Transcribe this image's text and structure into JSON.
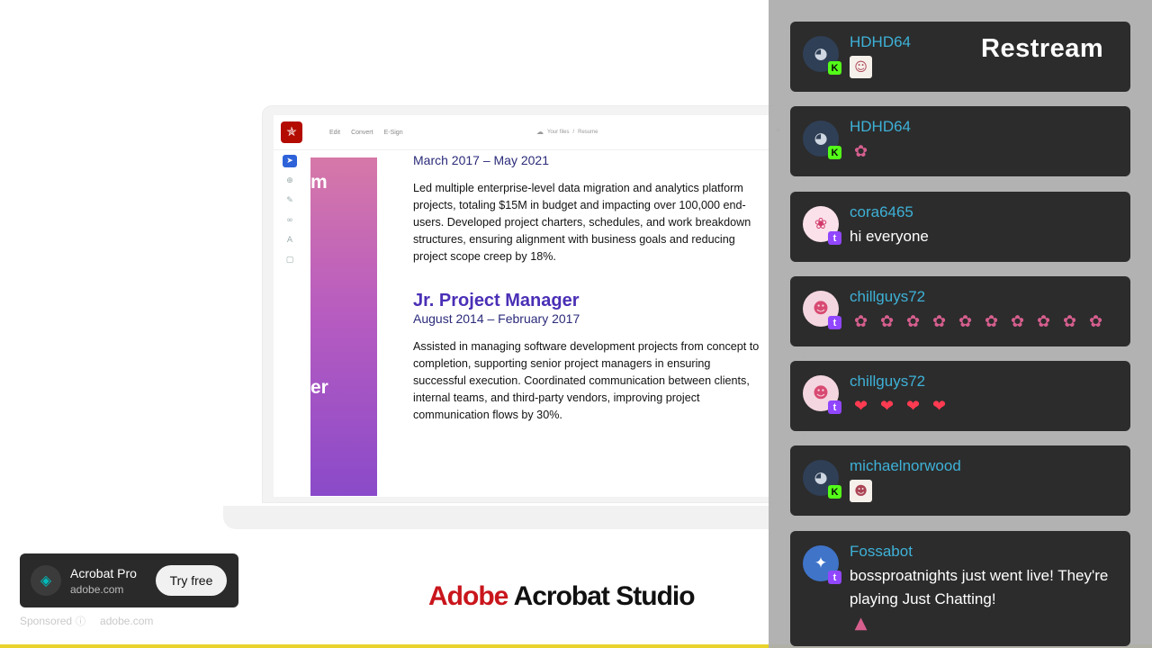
{
  "video": {
    "app": {
      "menu": [
        "Edit",
        "Convert",
        "E-Sign"
      ],
      "path": [
        "Your files",
        "/",
        "Resume"
      ]
    },
    "band_text": [
      "m",
      "er"
    ],
    "resume": {
      "date1": "March 2017 – May 2021",
      "para1": "Led multiple enterprise-level data migration and analytics platform projects, totaling $15M in budget and impacting over 100,000 end-users. Developed project charters, schedules, and work breakdown structures, ensuring alignment with business goals and reducing project scope creep by 18%.",
      "job_title": "Jr. Project Manager",
      "date2": "August 2014 – February 2017",
      "para2": "Assisted in managing software development projects from concept to completion, supporting senior project managers in ensuring successful execution. Coordinated communication between clients, internal teams, and third-party vendors, improving project communication flows by 30%."
    },
    "brand_word1": "Adobe",
    "brand_word2": "Acrobat Studio"
  },
  "ad": {
    "title": "Acrobat Pro",
    "url": "adobe.com",
    "cta": "Try free",
    "sponsored": "Sponsored",
    "sponsored_url": "adobe.com"
  },
  "chat": {
    "brand": "Restream",
    "messages": [
      {
        "user": "HDHD64",
        "platform": "kick",
        "text": "",
        "emotes": [
          "cat-emote"
        ]
      },
      {
        "user": "HDHD64",
        "platform": "kick",
        "text": "",
        "emotes": [
          "cat-emote"
        ]
      },
      {
        "user": "cora6465",
        "platform": "twitch",
        "text": "hi everyone",
        "emotes": []
      },
      {
        "user": "chillguys72",
        "platform": "twitch",
        "text": "",
        "emotes": [
          "hype-emote x10"
        ]
      },
      {
        "user": "chillguys72",
        "platform": "twitch",
        "text": "",
        "emotes": [
          "heart x4"
        ]
      },
      {
        "user": "michaelnorwood",
        "platform": "kick",
        "text": "",
        "emotes": [
          "anime-emote"
        ]
      },
      {
        "user": "Fossabot",
        "platform": "twitch",
        "text": "bossproatnights just went live! They're playing Just Chatting!",
        "emotes": [
          "dino-emote"
        ]
      }
    ]
  },
  "colors": {
    "username": "#3eb1d7",
    "message_bg": "#2c2c2c",
    "brand_red": "#c9151c",
    "job_title": "#4a2fb6",
    "stream_bar": "#e9d22b"
  }
}
